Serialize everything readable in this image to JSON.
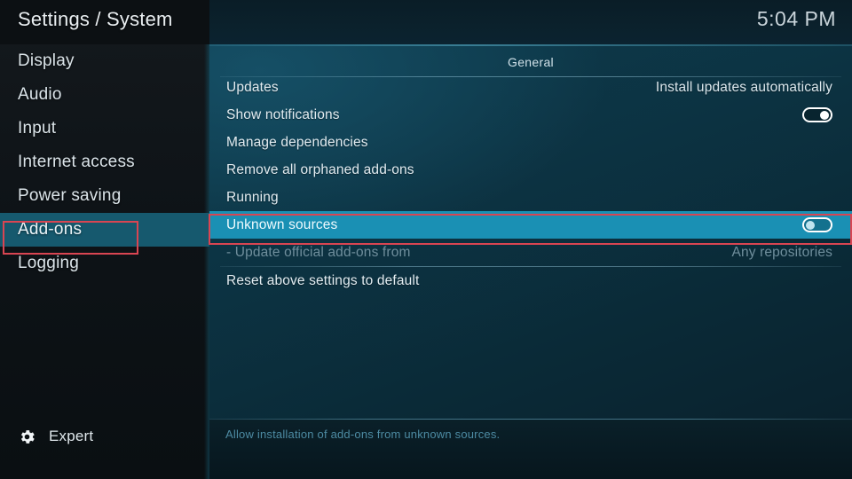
{
  "header": {
    "title": "Settings / System",
    "clock": "5:04 PM"
  },
  "sidebar": {
    "items": [
      {
        "label": "Display",
        "selected": false
      },
      {
        "label": "Audio",
        "selected": false
      },
      {
        "label": "Input",
        "selected": false
      },
      {
        "label": "Internet access",
        "selected": false
      },
      {
        "label": "Power saving",
        "selected": false
      },
      {
        "label": "Add-ons",
        "selected": true
      },
      {
        "label": "Logging",
        "selected": false
      }
    ],
    "level_button": {
      "icon": "gear-icon",
      "label": "Expert"
    }
  },
  "main": {
    "group_title": "General",
    "rows": [
      {
        "label": "Updates",
        "value": "Install updates automatically",
        "control": "text",
        "state": "normal",
        "rule_after": false
      },
      {
        "label": "Show notifications",
        "value": "",
        "control": "toggle",
        "state": "normal",
        "toggle": "on",
        "rule_after": false
      },
      {
        "label": "Manage dependencies",
        "value": "",
        "control": "none",
        "state": "normal",
        "rule_after": false
      },
      {
        "label": "Remove all orphaned add-ons",
        "value": "",
        "control": "none",
        "state": "normal",
        "rule_after": false
      },
      {
        "label": "Running",
        "value": "",
        "control": "none",
        "state": "normal",
        "rule_after": false
      },
      {
        "label": "Unknown sources",
        "value": "",
        "control": "toggle",
        "state": "focused",
        "toggle": "off",
        "rule_after": false
      },
      {
        "label": "- Update official add-ons from",
        "value": "Any repositories",
        "control": "text",
        "state": "disabled",
        "rule_after": true
      },
      {
        "label": "Reset above settings to default",
        "value": "",
        "control": "none",
        "state": "normal",
        "rule_after": false
      }
    ],
    "help_text": "Allow installation of add-ons from unknown sources."
  },
  "annotations": {
    "sidebar_box": {
      "target": "Add-ons",
      "color": "#d94552"
    },
    "row_box": {
      "target": "Unknown sources",
      "color": "#d94552"
    }
  }
}
